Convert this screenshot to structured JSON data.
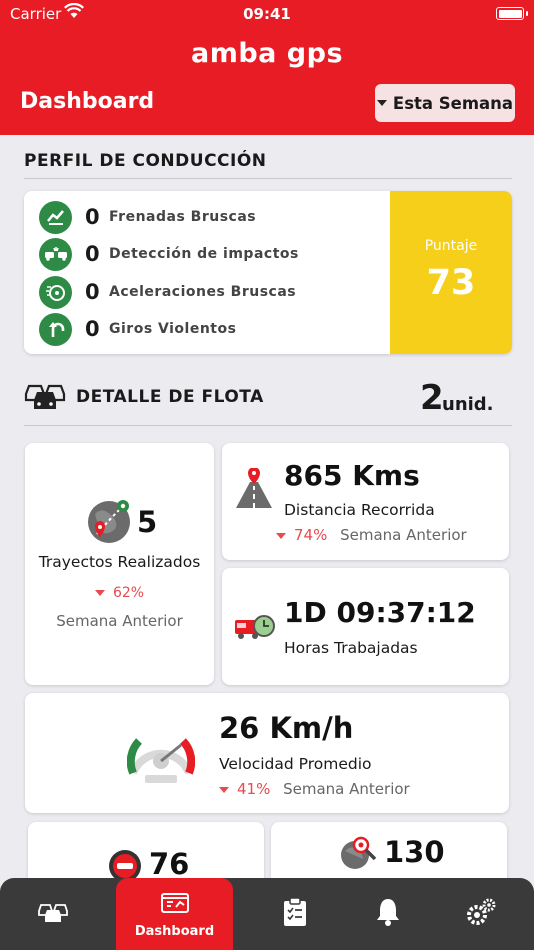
{
  "status": {
    "carrier": "Carrier",
    "time": "09:41"
  },
  "header": {
    "logo": "amba gps",
    "title": "Dashboard",
    "period": "Esta Semana"
  },
  "profile": {
    "title": "PERFIL DE CONDUCCIÓN",
    "items": [
      {
        "value": "0",
        "label": "Frenadas Bruscas",
        "icon": "brake-icon"
      },
      {
        "value": "0",
        "label": "Detección de impactos",
        "icon": "impact-icon"
      },
      {
        "value": "0",
        "label": "Aceleraciones Bruscas",
        "icon": "acceleration-icon"
      },
      {
        "value": "0",
        "label": "Giros Violentos",
        "icon": "turn-icon"
      }
    ],
    "score_label": "Puntaje",
    "score_value": "73"
  },
  "fleet": {
    "title": "DETALLE DE FLOTA",
    "count": "2",
    "unit": "unid.",
    "trips": {
      "value": "5",
      "label": "Trayectos Realizados",
      "change": "62%",
      "compare": "Semana Anterior"
    },
    "distance": {
      "value": "865 Kms",
      "label": "Distancia Recorrida",
      "change": "74%",
      "compare": "Semana Anterior"
    },
    "hours": {
      "value": "1D 09:37:12",
      "label": "Horas Trabajadas"
    },
    "speed": {
      "value": "26 Km/h",
      "label": "Velocidad Promedio",
      "change": "41%",
      "compare": "Semana Anterior"
    },
    "stops": {
      "value": "76"
    },
    "places": {
      "value": "130"
    }
  },
  "tabs": {
    "active_label": "Dashboard"
  },
  "colors": {
    "brand_red": "#e71c24",
    "score_yellow": "#f6cf1b",
    "icon_green": "#2e8b45",
    "decrease_red": "#e84a4f"
  }
}
